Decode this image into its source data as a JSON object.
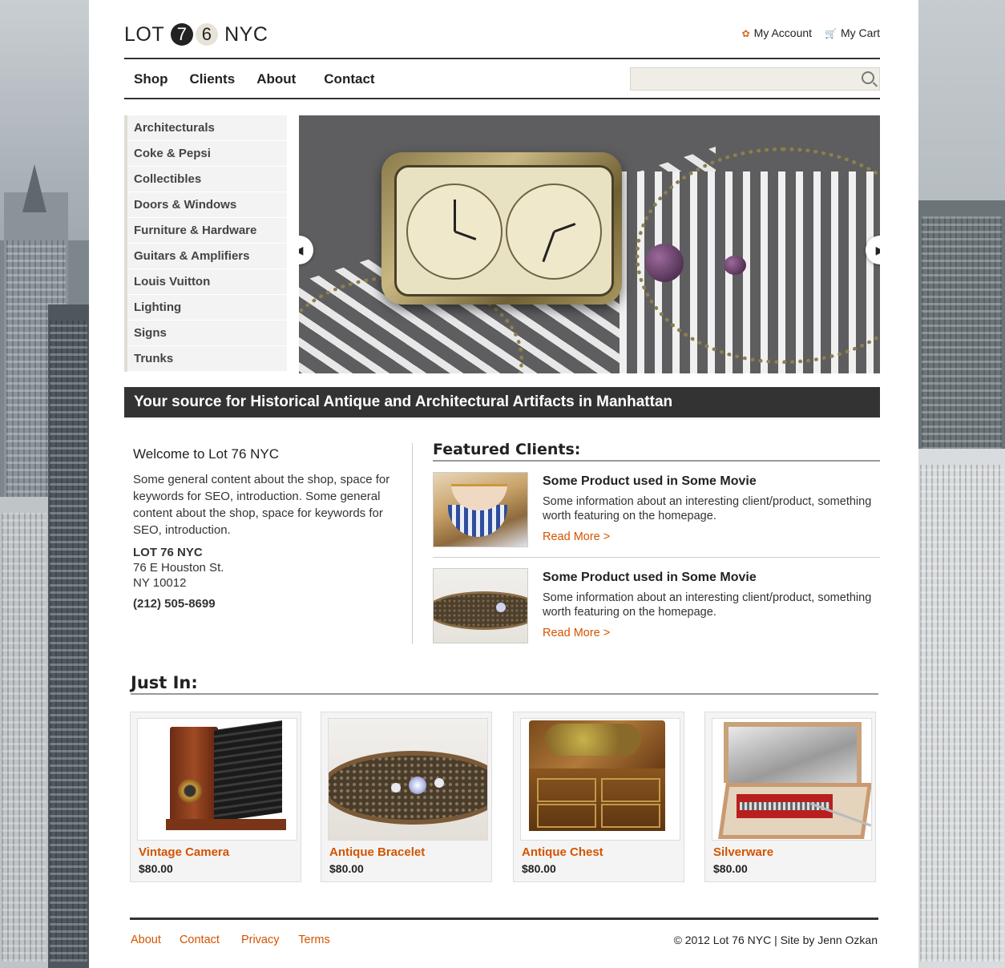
{
  "logo": {
    "part1": "LOT",
    "digit1": "7",
    "digit2": "6",
    "part2": "NYC"
  },
  "account": {
    "my_account": "My Account",
    "my_cart": "My Cart"
  },
  "nav": [
    "Shop",
    "Clients",
    "About",
    "Contact"
  ],
  "search": {
    "placeholder": ""
  },
  "categories": [
    "Architecturals",
    "Coke & Pepsi",
    "Collectibles",
    "Doors & Windows",
    "Furniture & Hardware",
    "Guitars & Amplifiers",
    "Louis Vuitton",
    "Lighting",
    "Signs",
    "Trunks"
  ],
  "banner": "Your source for Historical Antique and Architectural Artifacts in Manhattan",
  "welcome": {
    "title": "Welcome to Lot 76 NYC",
    "body": "Some general content about the shop, space for keywords for SEO, introduction. Some general content about the shop, space for keywords for SEO, introduction.",
    "name": "LOT 76 NYC",
    "street": "76 E Houston St.",
    "city": "NY 10012",
    "phone": "(212) 505-8699"
  },
  "featured": {
    "title": "Featured Clients:",
    "items": [
      {
        "title": "Some Product used in Some Movie",
        "desc": "Some information about an interesting client/product, something worth featuring on the homepage.",
        "link": "Read More >"
      },
      {
        "title": "Some Product used in Some Movie",
        "desc": "Some information about an interesting client/product, something worth featuring on the homepage.",
        "link": "Read More >"
      }
    ]
  },
  "just_in": {
    "title": "Just In:",
    "products": [
      {
        "name": "Vintage Camera",
        "price": "$80.00"
      },
      {
        "name": "Antique Bracelet",
        "price": "$80.00"
      },
      {
        "name": "Antique Chest",
        "price": "$80.00"
      },
      {
        "name": "Silverware",
        "price": "$80.00"
      }
    ]
  },
  "footer": {
    "links": [
      "About",
      "Contact",
      "Privacy",
      "Terms"
    ],
    "copyright": "© 2012 Lot 76 NYC | Site by Jenn Ozkan"
  },
  "colors": {
    "accent": "#d35400",
    "dark": "#333333",
    "search_bg": "#efede6"
  }
}
